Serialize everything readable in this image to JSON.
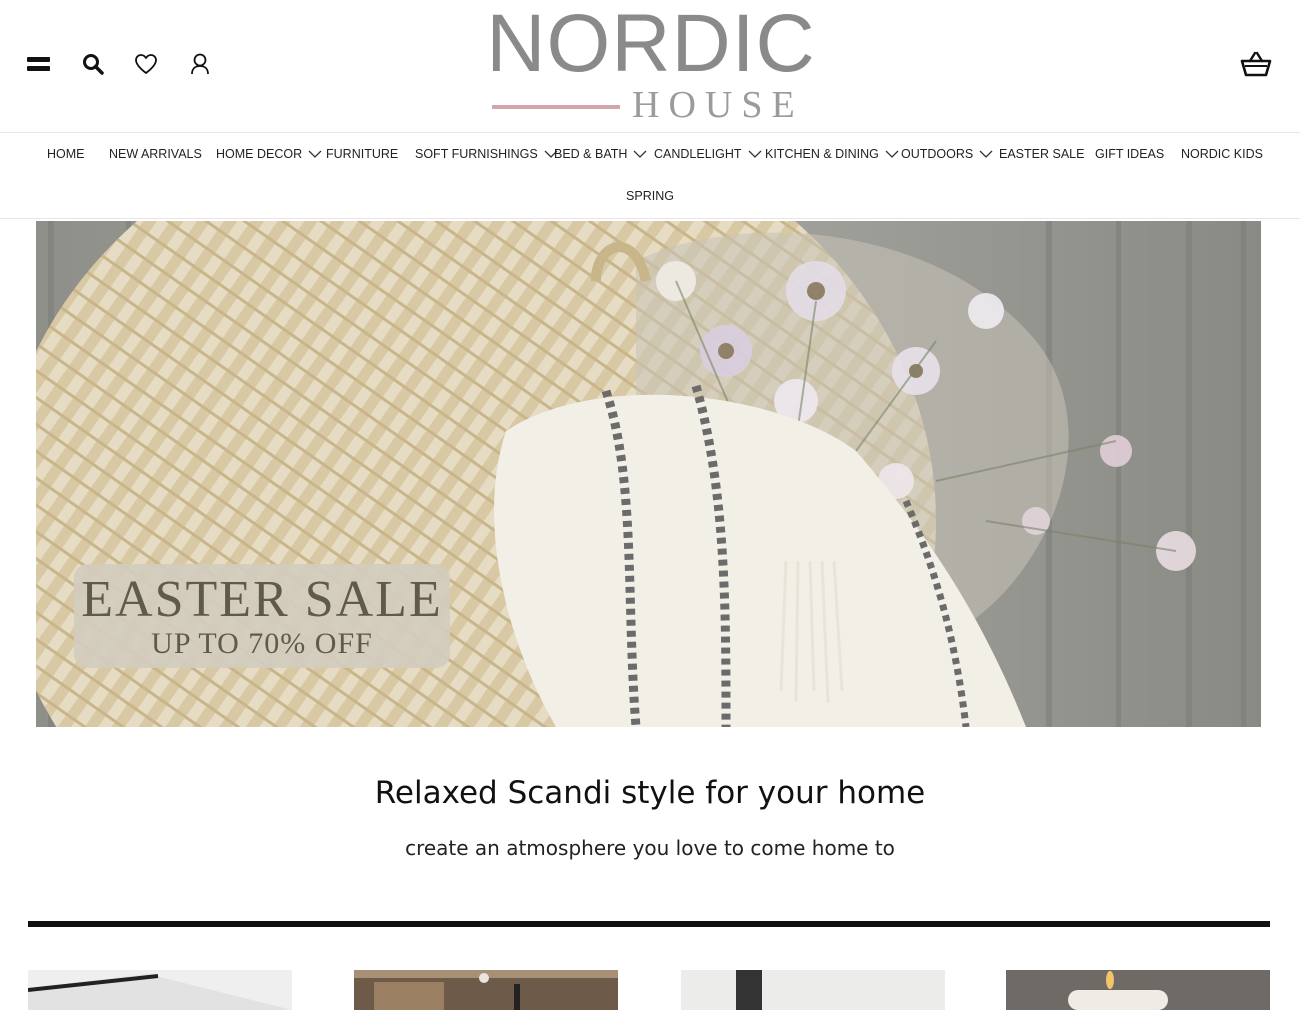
{
  "header": {
    "logo_main": "NORDIC",
    "logo_sub": "HOUSE",
    "icons": [
      "menu-icon",
      "search-icon",
      "heart-icon",
      "user-icon",
      "basket-icon"
    ]
  },
  "nav": {
    "items": [
      {
        "label": "HOME",
        "dropdown": false
      },
      {
        "label": "NEW ARRIVALS",
        "dropdown": false
      },
      {
        "label": "HOME DECOR",
        "dropdown": true
      },
      {
        "label": "FURNITURE",
        "dropdown": false
      },
      {
        "label": "SOFT FURNISHINGS",
        "dropdown": true
      },
      {
        "label": "BED & BATH",
        "dropdown": true
      },
      {
        "label": "CANDLELIGHT",
        "dropdown": true
      },
      {
        "label": "KITCHEN & DINING",
        "dropdown": true
      },
      {
        "label": "OUTDOORS",
        "dropdown": true
      },
      {
        "label": "EASTER SALE",
        "dropdown": false
      },
      {
        "label": "GIFT IDEAS",
        "dropdown": false
      },
      {
        "label": "NORDIC KIDS",
        "dropdown": false
      },
      {
        "label": "SPRING",
        "dropdown": false
      }
    ]
  },
  "hero": {
    "badge_title": "EASTER SALE",
    "badge_subtitle": "UP TO 70% OFF"
  },
  "intro": {
    "heading": "Relaxed Scandi style for your home",
    "subheading": "create an atmosphere you love to come home to"
  },
  "colors": {
    "accent_pink": "#d4a5ab",
    "logo_grey": "#8a8a8a",
    "badge_bg": "#d2ccbe",
    "text_dark": "#111111"
  }
}
